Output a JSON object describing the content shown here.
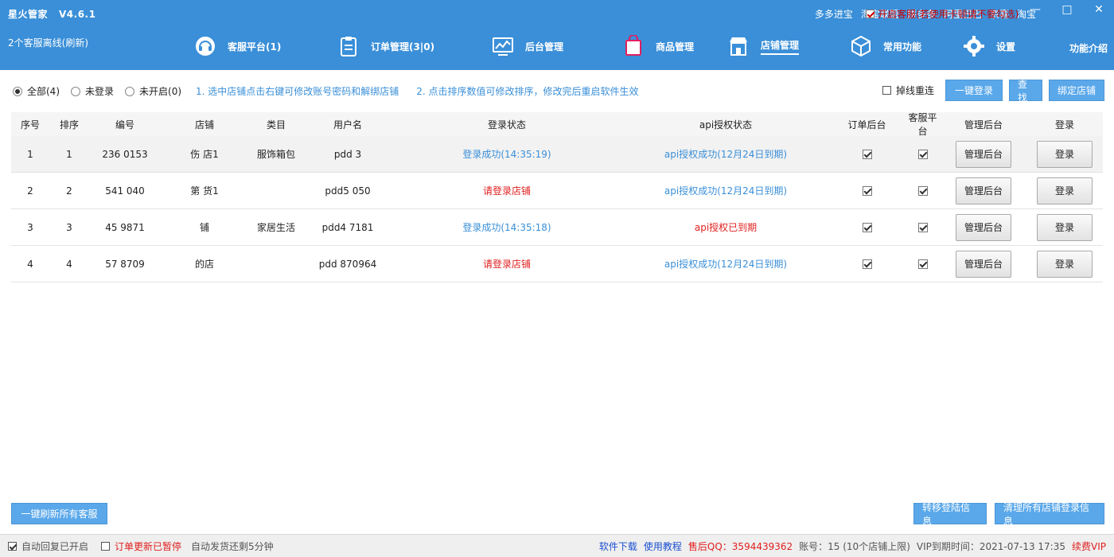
{
  "header": {
    "app_name": "星火管家",
    "version": "V4.6.1",
    "service_status": "2个客服离线(刷新)",
    "top_links": [
      "多多进宝",
      "淘宝联盟",
      "拼多多",
      "阿里巴巴",
      "京喜",
      "淘宝"
    ],
    "cs_toggle_label": "开启客服(若使用卡顿请不要勾选)",
    "window_minimize": "—",
    "window_maximize": "□",
    "window_close": "✕",
    "func_intro": "功能介绍",
    "nav": [
      {
        "label": "客服平台(1)",
        "icon": "headset-icon"
      },
      {
        "label": "订单管理(3|0)",
        "icon": "clipboard-icon"
      },
      {
        "label": "后台管理",
        "icon": "monitor-chart-icon"
      },
      {
        "label": "商品管理",
        "icon": "shopping-bag-icon"
      },
      {
        "label": "店铺管理",
        "icon": "storefront-icon"
      },
      {
        "label": "常用功能",
        "icon": "cube-icon"
      },
      {
        "label": "设置",
        "icon": "gear-icon"
      }
    ],
    "active_nav": "店铺管理",
    "colors": {
      "header_bg": "#3a8fd8",
      "error": "#e02020",
      "link": "#3a8fd8"
    }
  },
  "filters": {
    "all": "全部(4)",
    "not_logged": "未登录",
    "not_open": "未开启(0)",
    "hint1": "1. 选中店铺点击右键可修改账号密码和解绑店铺",
    "hint2": "2. 点击排序数值可修改排序，修改完后重启软件生效"
  },
  "actions": {
    "reconnect": "掉线重连",
    "one_key_login": "一键登录",
    "search": "查找",
    "bind_shop": "绑定店铺"
  },
  "table": {
    "headers": {
      "seq": "序号",
      "sort": "排序",
      "code": "编号",
      "shop": "店铺",
      "category": "类目",
      "username": "用户名",
      "login_status": "登录状态",
      "api_status": "api授权状态",
      "order_admin": "订单后台",
      "cs_platform": "客服平台",
      "manage_admin": "管理后台",
      "login": "登录"
    },
    "rows": [
      {
        "seq": "1",
        "sort": "1",
        "code": "236   0153",
        "shop": "伤    店1",
        "category": "服饰箱包",
        "username": "pdd           3",
        "login_status": "登录成功(14:35:19)",
        "login_ok": true,
        "api_status": "api授权成功(12月24日到期)",
        "api_ok": true
      },
      {
        "seq": "2",
        "sort": "2",
        "code": "541   040",
        "shop": "第    货1",
        "category": "",
        "username": "pdd5        050",
        "login_status": "请登录店铺",
        "login_ok": false,
        "api_status": "api授权成功(12月24日到期)",
        "api_ok": true
      },
      {
        "seq": "3",
        "sort": "3",
        "code": "45   9871",
        "shop": "      铺",
        "category": "家居生活",
        "username": "pdd4      7181",
        "login_status": "登录成功(14:35:18)",
        "login_ok": true,
        "api_status": "api授权已到期",
        "api_ok": false
      },
      {
        "seq": "4",
        "sort": "4",
        "code": "57   8709",
        "shop": "     的店",
        "category": "",
        "username": "pdd     870964",
        "login_status": "请登录店铺",
        "login_ok": false,
        "api_status": "api授权成功(12月24日到期)",
        "api_ok": true
      }
    ],
    "manage_btn": "管理后台",
    "login_btn": "登录"
  },
  "bottom": {
    "refresh_all": "一键刷新所有客服",
    "move_login": "转移登陆信息",
    "clear_login": "清理所有店铺登录信息"
  },
  "statusbar": {
    "auto_reply": "自动回复已开启",
    "order_update": "订单更新已暂停",
    "auto_ship": "自动发货还剩5分钟",
    "download": "软件下载",
    "tutorial": "使用教程",
    "qq": "售后QQ：3594439362",
    "account": "账号：15          (10个店铺上限)",
    "vip_expire": "VIP到期时间：2021-07-13 17:35",
    "renew": "续费VIP"
  }
}
